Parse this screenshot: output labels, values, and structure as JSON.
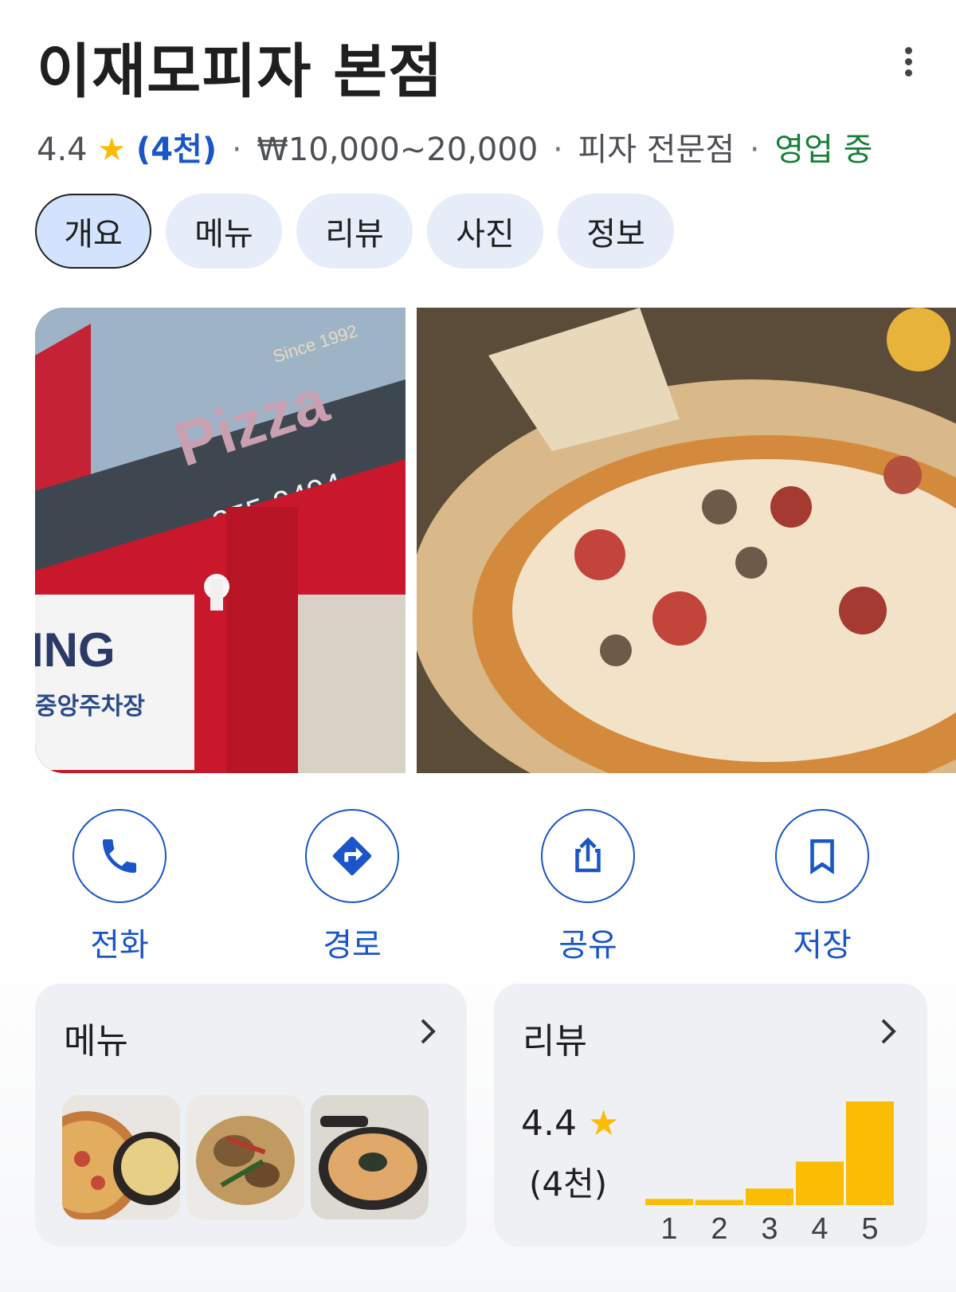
{
  "place": {
    "name": "이재모피자 본점",
    "rating": "4.4",
    "review_count": "(4천)",
    "price_range": "₩10,000~20,000",
    "category": "피자 전문점",
    "status": "영업 중",
    "separator": "·",
    "star": "★"
  },
  "tabs": [
    {
      "label": "개요",
      "active": true
    },
    {
      "label": "메뉴",
      "active": false
    },
    {
      "label": "리뷰",
      "active": false
    },
    {
      "label": "사진",
      "active": false
    },
    {
      "label": "정보",
      "active": false
    }
  ],
  "photos": [
    {
      "icon": "storefront-photo",
      "sign_text": "Pizza",
      "phone": "255-9494",
      "since": "Since 1992",
      "parking": "중앙주차장"
    },
    {
      "icon": "pizza-photo"
    }
  ],
  "actions": [
    {
      "label": "전화",
      "icon": "phone-icon"
    },
    {
      "label": "경로",
      "icon": "directions-icon"
    },
    {
      "label": "공유",
      "icon": "share-icon"
    },
    {
      "label": "저장",
      "icon": "bookmark-icon"
    }
  ],
  "menu_card": {
    "title": "메뉴",
    "thumbnails": [
      "pizza-and-gratin-photo",
      "pasta-photo",
      "risotto-photo"
    ]
  },
  "review_card": {
    "title": "리뷰",
    "rating": "4.4",
    "count": "(4천)",
    "histogram": {
      "labels": [
        "1",
        "2",
        "3",
        "4",
        "5"
      ],
      "values": [
        0.06,
        0.05,
        0.16,
        0.42,
        1.0
      ]
    }
  },
  "colors": {
    "accent": "#1a56c8",
    "star": "#fbbc04",
    "open": "#188038",
    "bar": "#fbbc04",
    "tab_bg": "#e6ecf8",
    "card_bg": "#eef0f3"
  }
}
